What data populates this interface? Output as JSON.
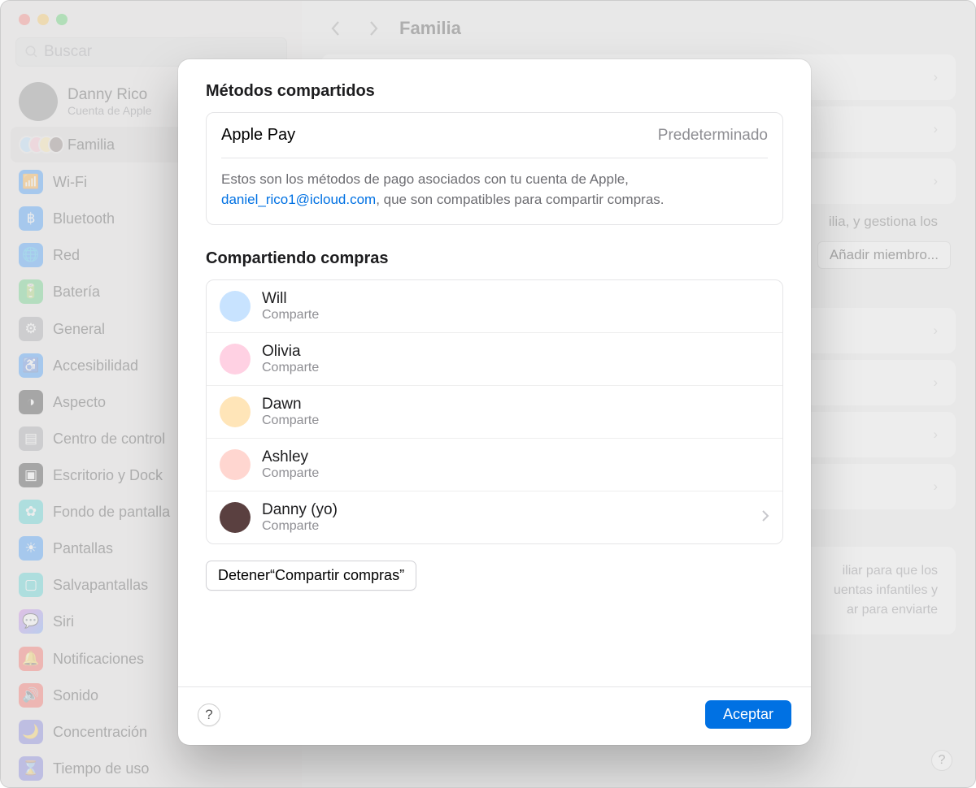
{
  "window": {
    "title": "Familia"
  },
  "search": {
    "placeholder": "Buscar"
  },
  "account": {
    "name": "Danny Rico",
    "subtitle": "Cuenta de Apple"
  },
  "sidebar": {
    "family_label": "Familia",
    "items": [
      "Wi-Fi",
      "Bluetooth",
      "Red",
      "Batería",
      "General",
      "Accesibilidad",
      "Aspecto",
      "Centro de control",
      "Escritorio y Dock",
      "Fondo de pantalla",
      "Pantallas",
      "Salvapantallas",
      "Siri",
      "Notificaciones",
      "Sonido",
      "Concentración",
      "Tiempo de uso"
    ]
  },
  "background": {
    "add_member": "Añadir miembro...",
    "desc_fragment": "ilia, y gestiona los",
    "card_text_1": "iliar para que los",
    "card_text_2": "uentas infantiles y",
    "card_text_3": "ar para enviarte"
  },
  "modal": {
    "section1_title": "Métodos compartidos",
    "pay_method": "Apple Pay",
    "pay_status": "Predeterminado",
    "pay_desc_prefix": "Estos son los métodos de pago asociados con tu cuenta de Apple, ",
    "pay_email": "daniel_rico1@icloud.com",
    "pay_desc_suffix": ", que son compatibles para compartir compras.",
    "section2_title": "Compartiendo compras",
    "members": [
      {
        "name": "Will",
        "status": "Comparte",
        "color": "#c8e3ff",
        "chevron": false
      },
      {
        "name": "Olivia",
        "status": "Comparte",
        "color": "#ffd1e3",
        "chevron": false
      },
      {
        "name": "Dawn",
        "status": "Comparte",
        "color": "#ffe5b8",
        "chevron": false
      },
      {
        "name": "Ashley",
        "status": "Comparte",
        "color": "#ffd6d0",
        "chevron": false
      },
      {
        "name": "Danny (yo)",
        "status": "Comparte",
        "color": "#5a4040",
        "chevron": true
      }
    ],
    "stop_button": "Detener“Compartir compras”",
    "help": "?",
    "accept": "Aceptar"
  }
}
